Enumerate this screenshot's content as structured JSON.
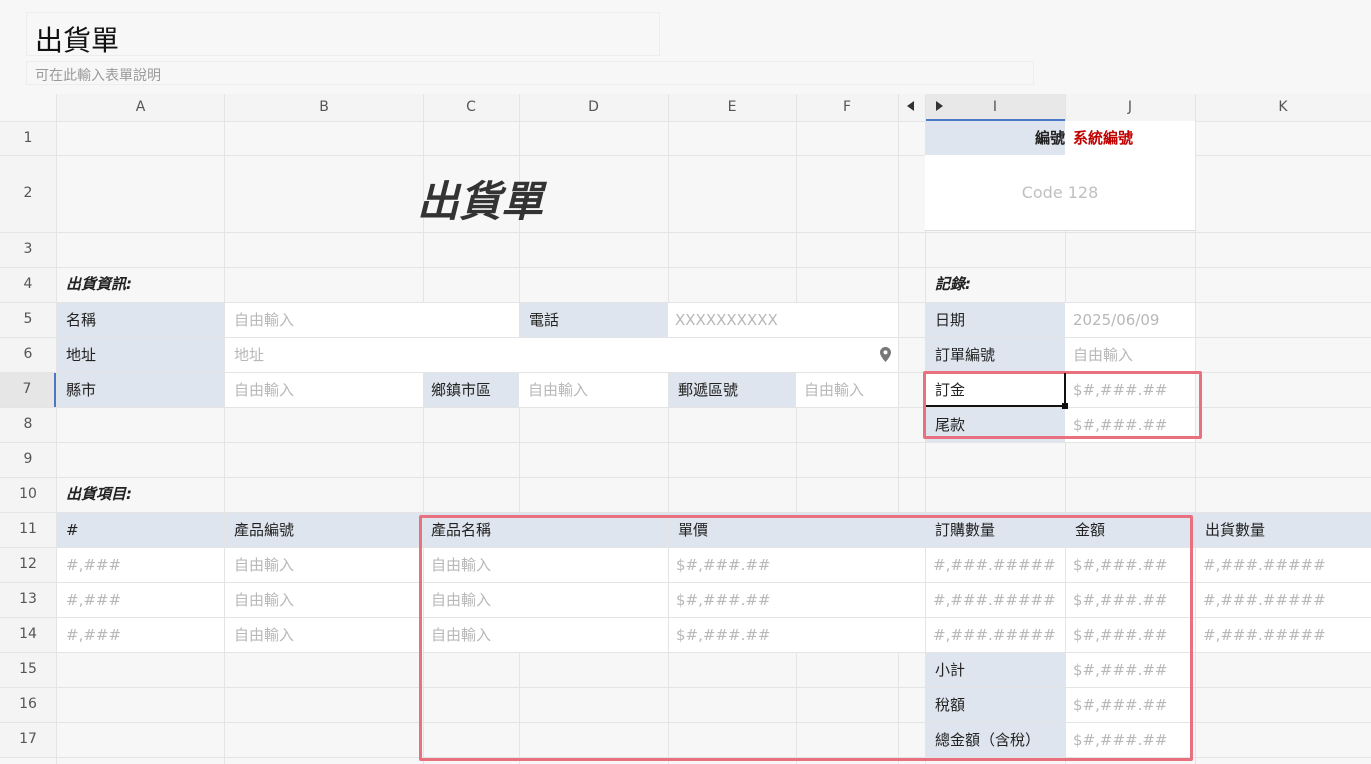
{
  "header": {
    "title": "出貨單",
    "description": "可在此輸入表單說明"
  },
  "columns": [
    "A",
    "B",
    "C",
    "D",
    "E",
    "F",
    "I",
    "J",
    "K"
  ],
  "rows": [
    "1",
    "2",
    "3",
    "4",
    "5",
    "6",
    "7",
    "8",
    "9",
    "10",
    "11",
    "12",
    "13",
    "14",
    "15",
    "16",
    "17"
  ],
  "sheet": {
    "big_title": "出貨單",
    "serial_label": "編號",
    "serial_value": "系統編號",
    "barcode": "Code 128",
    "ship_info_title": "出貨資訊:",
    "record_title": "記錄:",
    "name_label": "名稱",
    "name_ph": "自由輸入",
    "phone_label": "電話",
    "phone_ph": "XXXXXXXXXX",
    "address_label": "地址",
    "address_ph": "地址",
    "city_label": "縣市",
    "city_ph": "自由輸入",
    "district_label": "鄉鎮市區",
    "district_ph": "自由輸入",
    "zip_label": "郵遞區號",
    "zip_ph": "自由輸入",
    "date_label": "日期",
    "date_value": "2025/06/09",
    "order_label": "訂單編號",
    "order_ph": "自由輸入",
    "deposit_label": "訂金",
    "deposit_ph": "$#,###.##",
    "balance_label": "尾款",
    "balance_ph": "$#,###.##",
    "items_title": "出貨項目:",
    "items_headers": [
      "#",
      "產品編號",
      "產品名稱",
      "單價",
      "訂購數量",
      "金額",
      "出貨數量"
    ],
    "item_rows": [
      [
        "#,###",
        "自由輸入",
        "自由輸入",
        "$#,###.##",
        "#,###.#####",
        "$#,###.##",
        "#,###.#####"
      ],
      [
        "#,###",
        "自由輸入",
        "自由輸入",
        "$#,###.##",
        "#,###.#####",
        "$#,###.##",
        "#,###.#####"
      ],
      [
        "#,###",
        "自由輸入",
        "自由輸入",
        "$#,###.##",
        "#,###.#####",
        "$#,###.##",
        "#,###.#####"
      ]
    ],
    "subtotal_label": "小計",
    "subtotal_ph": "$#,###.##",
    "tax_label": "稅額",
    "tax_ph": "$#,###.##",
    "total_label": "總金額（含稅）",
    "total_ph": "$#,###.##"
  },
  "colors": {
    "label_bg": "#dfe5ee",
    "highlight": "#e9707f",
    "serial_red": "#c00000"
  }
}
